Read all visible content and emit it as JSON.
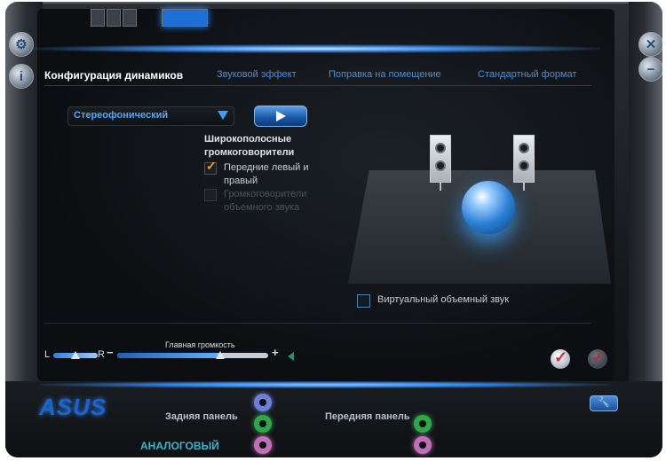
{
  "header": {
    "info_icon": "i-icon",
    "settings_icon": "gear-icon"
  },
  "tabs": [
    {
      "label": "Конфигурация динамиков",
      "active": true
    },
    {
      "label": "Звуковой эффект",
      "active": false
    },
    {
      "label": "Поправка на помещение",
      "active": false
    },
    {
      "label": "Стандартный формат",
      "active": false
    }
  ],
  "config": {
    "speaker_mode": "Стереофонический",
    "fullrange_heading": "Широкополосные громкоговорители",
    "checkboxes": [
      {
        "label": "Передние левый и правый",
        "checked": true,
        "enabled": true
      },
      {
        "label": "Громкоговорители объемного звука",
        "checked": false,
        "enabled": false
      }
    ],
    "virtual_surround_label": "Виртуальный объемный звук",
    "virtual_surround_checked": false
  },
  "volume": {
    "title": "Главная громкость",
    "left_label": "L",
    "right_label": "R",
    "minus": "−",
    "plus": "+",
    "balance_level": 0.5,
    "master_level": 0.68
  },
  "bottom": {
    "brand": "ASUS",
    "rear_panel_label": "Задняя панель",
    "front_panel_label": "Передняя панель",
    "analog_label": "АНАЛОГОВЫЙ",
    "jack_colors": {
      "rear": [
        "#6f7fd8",
        "#2fa64a",
        "#c06fb8"
      ],
      "front": [
        "#2fa64a",
        "#c06fb8"
      ]
    }
  },
  "colors": {
    "accent": "#3d8fe6",
    "check": "#ff9e1a",
    "tab_inactive": "#4d8fd0"
  }
}
